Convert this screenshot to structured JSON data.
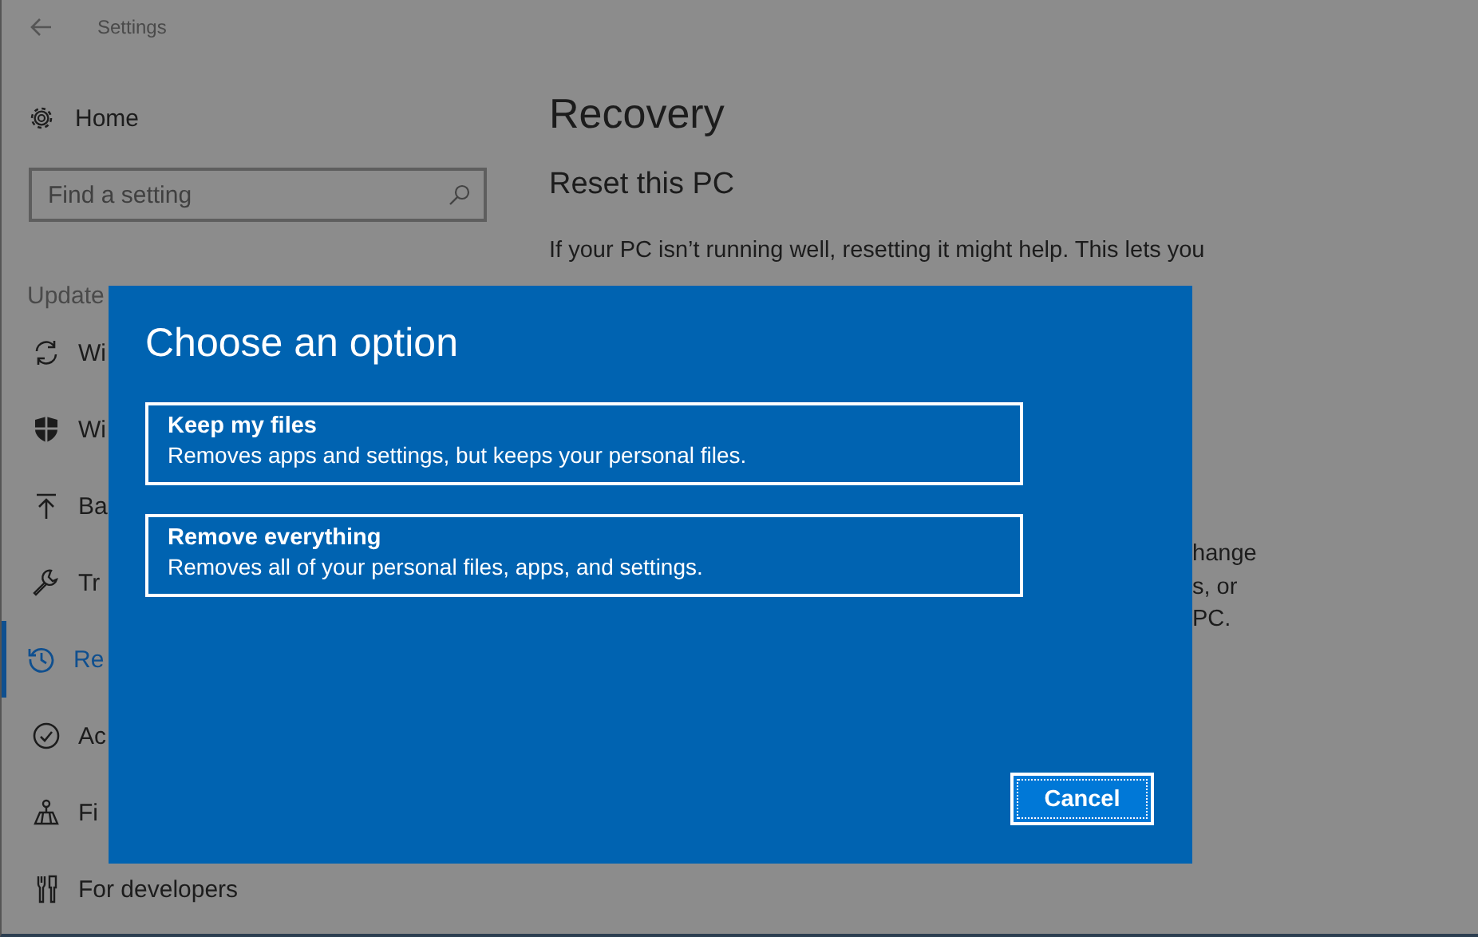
{
  "window": {
    "title": "Settings"
  },
  "sidebar": {
    "home": "Home",
    "search": {
      "placeholder": "Find a setting"
    },
    "section": "Update",
    "items": [
      {
        "label": "Wi",
        "kind": "sync",
        "selected": false
      },
      {
        "label": "Wi",
        "kind": "shield",
        "selected": false
      },
      {
        "label": "Ba",
        "kind": "upload",
        "selected": false
      },
      {
        "label": "Tr",
        "kind": "wrench",
        "selected": false
      },
      {
        "label": "Re",
        "kind": "history",
        "selected": true
      },
      {
        "label": "Ac",
        "kind": "check",
        "selected": false
      },
      {
        "label": "Fi",
        "kind": "locate",
        "selected": false
      },
      {
        "label": "For developers",
        "kind": "tools",
        "selected": false
      }
    ]
  },
  "content": {
    "title": "Recovery",
    "heading": "Reset this PC",
    "text": "If your PC isn’t running well, resetting it might help. This lets you",
    "fragments": [
      "hange",
      "s, or",
      "PC."
    ]
  },
  "dialog": {
    "title": "Choose an option",
    "options": [
      {
        "title": "Keep my files",
        "description": "Removes apps and settings, but keeps your personal files."
      },
      {
        "title": "Remove everything",
        "description": "Removes all of your personal files, apps, and settings."
      }
    ],
    "cancel": "Cancel"
  }
}
